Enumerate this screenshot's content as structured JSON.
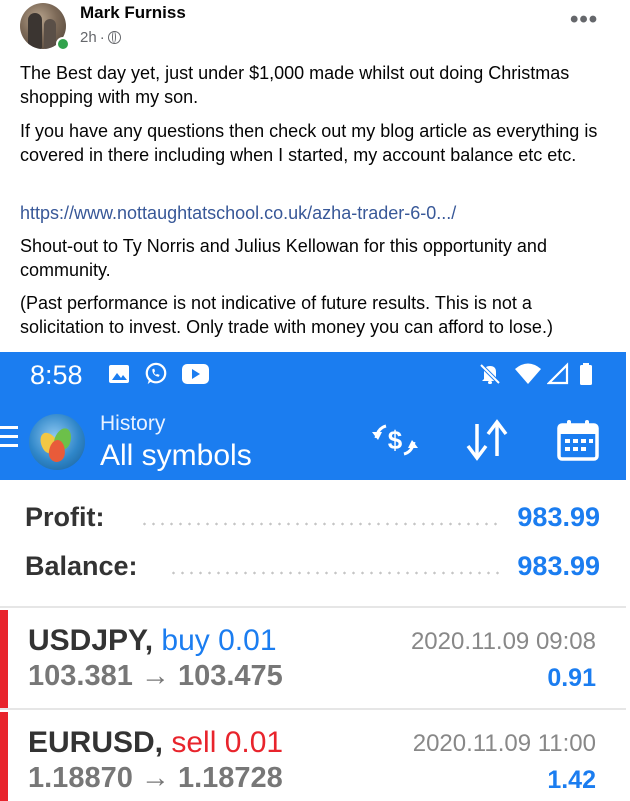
{
  "post": {
    "author": "Mark Furniss",
    "time": "2h",
    "separator": "·",
    "paragraphs": [
      "The Best day yet, just under $1,000 made whilst out doing Christmas shopping with my son.",
      "If you have any questions then check out my blog article as everything is covered in there including when I started, my account balance etc etc.",
      "https://www.nottaughtatschool.co.uk/azha-trader-6-0.../",
      "Shout-out to Ty Norris and Julius Kellowan for this opportunity and community.",
      "(Past performance is not indicative of future results. This is not a solicitation to invest. Only trade with money you can afford to lose.)"
    ],
    "more_label": "•••"
  },
  "phone": {
    "status_time": "8:58",
    "header_title": "History",
    "header_subtitle": "All symbols",
    "accent_color": "#1b7df0",
    "summary": [
      {
        "label": "Profit:",
        "value": "983.99"
      },
      {
        "label": "Balance:",
        "value": "983.99"
      }
    ],
    "trades": [
      {
        "symbol": "USDJPY,",
        "side": "buy 0.01",
        "side_color": "#1b7df0",
        "open": "103.381",
        "arrow": "→",
        "close": "103.475",
        "date": "2020.11.09 09:08",
        "profit": "0.91"
      },
      {
        "symbol": "EURUSD,",
        "side": "sell 0.01",
        "side_color": "#e8242c",
        "open": "1.18870",
        "arrow": "→",
        "close": "1.18728",
        "date": "2020.11.09 11:00",
        "profit": "1.42"
      }
    ]
  },
  "icons": [
    "globe-icon",
    "image-icon",
    "whatsapp-icon",
    "youtube-icon",
    "mute-bell-icon",
    "wifi-icon",
    "signal-icon",
    "battery-icon",
    "menu-icon",
    "metatrader-logo-icon",
    "currency-exchange-icon",
    "sort-icon",
    "calendar-icon"
  ]
}
